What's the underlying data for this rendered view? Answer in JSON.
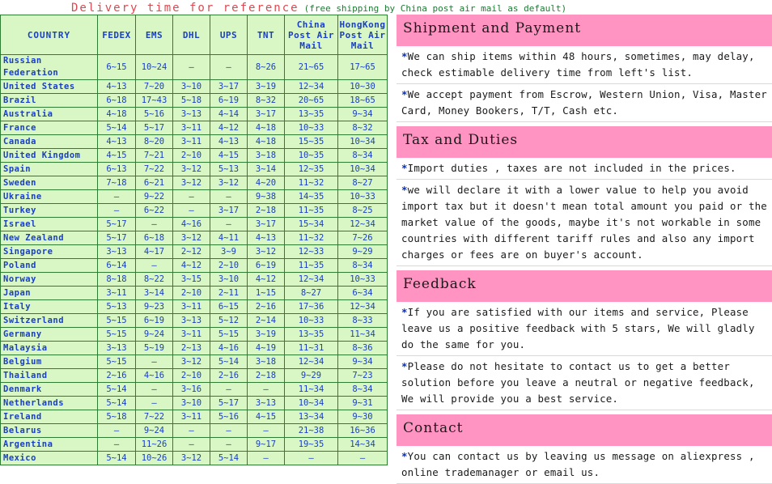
{
  "title": {
    "main": "Delivery time for reference",
    "sub": "(free shipping by China post air mail as default)"
  },
  "colors": {
    "title_main": "#d94a52",
    "title_sub": "#1e7a34",
    "table_bg": "#d8f7c4",
    "table_border": "#2e7d32",
    "table_text": "#1a3fc4",
    "section_header_bg": "#ff94c2",
    "bullet_star": "#0a2fc0"
  },
  "table": {
    "headers": [
      "COUNTRY",
      "FEDEX",
      "EMS",
      "DHL",
      "UPS",
      "TNT",
      "China Post Air Mail",
      "HongKong Post Air Mail"
    ],
    "rows": [
      {
        "country": "Russian Federation",
        "fedex": "6~15",
        "ems": "10~24",
        "dhl": "—",
        "ups": "—",
        "tnt": "8~26",
        "china": "21~65",
        "hk": "17~65",
        "tall": true
      },
      {
        "country": "United States",
        "fedex": "4~13",
        "ems": "7~20",
        "dhl": "3~10",
        "ups": "3~17",
        "tnt": "3~19",
        "china": "12~34",
        "hk": "10~30"
      },
      {
        "country": "Brazil",
        "fedex": "6~18",
        "ems": "17~43",
        "dhl": "5~18",
        "ups": "6~19",
        "tnt": "8~32",
        "china": "20~65",
        "hk": "18~65"
      },
      {
        "country": "Australia",
        "fedex": "4~18",
        "ems": "5~16",
        "dhl": "3~13",
        "ups": "4~14",
        "tnt": "3~17",
        "china": "13~35",
        "hk": "9~34"
      },
      {
        "country": "France",
        "fedex": "5~14",
        "ems": "5~17",
        "dhl": "3~11",
        "ups": "4~12",
        "tnt": "4~18",
        "china": "10~33",
        "hk": "8~32"
      },
      {
        "country": "Canada",
        "fedex": "4~13",
        "ems": "8~20",
        "dhl": "3~11",
        "ups": "4~13",
        "tnt": "4~18",
        "china": "15~35",
        "hk": "10~34"
      },
      {
        "country": "United Kingdom",
        "fedex": "4~15",
        "ems": "7~21",
        "dhl": "2~10",
        "ups": "4~15",
        "tnt": "3~18",
        "china": "10~35",
        "hk": "8~34"
      },
      {
        "country": "Spain",
        "fedex": "6~13",
        "ems": "7~22",
        "dhl": "3~12",
        "ups": "5~13",
        "tnt": "3~14",
        "china": "12~35",
        "hk": "10~34"
      },
      {
        "country": "Sweden",
        "fedex": "7~18",
        "ems": "6~21",
        "dhl": "3~12",
        "ups": "3~12",
        "tnt": "4~20",
        "china": "11~32",
        "hk": "8~27"
      },
      {
        "country": "Ukraine",
        "fedex": "—",
        "ems": "9~22",
        "dhl": "—",
        "ups": "—",
        "tnt": "9~38",
        "china": "14~35",
        "hk": "10~33"
      },
      {
        "country": "Turkey",
        "fedex": "—",
        "ems": "6~22",
        "dhl": "—",
        "ups": "3~17",
        "tnt": "2~18",
        "china": "11~35",
        "hk": "8~25"
      },
      {
        "country": "Israel",
        "fedex": "5~17",
        "ems": "—",
        "dhl": "4~16",
        "ups": "—",
        "tnt": "3~17",
        "china": "15~34",
        "hk": "12~34"
      },
      {
        "country": "New Zealand",
        "fedex": "5~17",
        "ems": "6~18",
        "dhl": "3~12",
        "ups": "4~11",
        "tnt": "4~13",
        "china": "11~32",
        "hk": "7~26"
      },
      {
        "country": "Singapore",
        "fedex": "3~13",
        "ems": "4~17",
        "dhl": "2~12",
        "ups": "3~9",
        "tnt": "3~12",
        "china": "12~33",
        "hk": "9~29"
      },
      {
        "country": "Poland",
        "fedex": "6~14",
        "ems": "—",
        "dhl": "4~12",
        "ups": "2~10",
        "tnt": "6~19",
        "china": "11~35",
        "hk": "8~34"
      },
      {
        "country": "Norway",
        "fedex": "8~18",
        "ems": "8~22",
        "dhl": "3~15",
        "ups": "3~10",
        "tnt": "4~12",
        "china": "12~34",
        "hk": "10~33"
      },
      {
        "country": "Japan",
        "fedex": "3~11",
        "ems": "3~14",
        "dhl": "2~10",
        "ups": "2~11",
        "tnt": "1~15",
        "china": "8~27",
        "hk": "6~34"
      },
      {
        "country": "Italy",
        "fedex": "5~13",
        "ems": "9~23",
        "dhl": "3~11",
        "ups": "6~15",
        "tnt": "2~16",
        "china": "17~36",
        "hk": "12~34"
      },
      {
        "country": "Switzerland",
        "fedex": "5~15",
        "ems": "6~19",
        "dhl": "3~13",
        "ups": "5~12",
        "tnt": "2~14",
        "china": "10~33",
        "hk": "8~33"
      },
      {
        "country": "Germany",
        "fedex": "5~15",
        "ems": "9~24",
        "dhl": "3~11",
        "ups": "5~15",
        "tnt": "3~19",
        "china": "13~35",
        "hk": "11~34"
      },
      {
        "country": "Malaysia",
        "fedex": "3~13",
        "ems": "5~19",
        "dhl": "2~13",
        "ups": "4~16",
        "tnt": "4~19",
        "china": "11~31",
        "hk": "8~36"
      },
      {
        "country": "Belgium",
        "fedex": "5~15",
        "ems": "—",
        "dhl": "3~12",
        "ups": "5~14",
        "tnt": "3~18",
        "china": "12~34",
        "hk": "9~34"
      },
      {
        "country": "Thailand",
        "fedex": "2~16",
        "ems": "4~16",
        "dhl": "2~10",
        "ups": "2~16",
        "tnt": "2~18",
        "china": "9~29",
        "hk": "7~23"
      },
      {
        "country": "Denmark",
        "fedex": "5~14",
        "ems": "—",
        "dhl": "3~16",
        "ups": "—",
        "tnt": "—",
        "china": "11~34",
        "hk": "8~34"
      },
      {
        "country": "Netherlands",
        "fedex": "5~14",
        "ems": "—",
        "dhl": "3~10",
        "ups": "5~17",
        "tnt": "3~13",
        "china": "10~34",
        "hk": "9~31"
      },
      {
        "country": "Ireland",
        "fedex": "5~18",
        "ems": "7~22",
        "dhl": "3~11",
        "ups": "5~16",
        "tnt": "4~15",
        "china": "13~34",
        "hk": "9~30"
      },
      {
        "country": "Belarus",
        "fedex": "—",
        "ems": "9~24",
        "dhl": "—",
        "ups": "—",
        "tnt": "—",
        "china": "21~38",
        "hk": "16~36"
      },
      {
        "country": "Argentina",
        "fedex": "—",
        "ems": "11~26",
        "dhl": "—",
        "ups": "—",
        "tnt": "9~17",
        "china": "19~35",
        "hk": "14~34"
      },
      {
        "country": "Mexico",
        "fedex": "5~14",
        "ems": "10~26",
        "dhl": "3~12",
        "ups": "5~14",
        "tnt": "—",
        "china": "—",
        "hk": "—"
      }
    ]
  },
  "panel": {
    "sections": [
      {
        "heading": "Shipment and Payment",
        "paras": [
          "*We can ship items within 48 hours, sometimes, may delay, check estimable delivery time from left's list.",
          "*We accept payment from Escrow, Western Union, Visa, Master Card, Money Bookers, T/T, Cash etc."
        ]
      },
      {
        "heading": "Tax and Duties",
        "paras": [
          "*Import duties , taxes are not included in the prices.",
          "*we will declare it with a lower value to help you avoid import tax but it doesn't mean total amount you paid or the market value of the goods, maybe it's not workable in some countries with different tariff rules and also any import charges or fees are on buyer's account."
        ]
      },
      {
        "heading": "Feedback",
        "paras": [
          "*If you are satisfied with our items and service, Please leave us a positive feedback with 5 stars, We will gladly do the same for you.",
          "*Please do not hesitate to contact us to get a better solution before you leave a neutral or negative feedback, We will provide you a best service."
        ]
      },
      {
        "heading": "Contact",
        "paras": [
          "*You can contact us by leaving us message on aliexpress , online trademanager or email us."
        ]
      }
    ]
  }
}
